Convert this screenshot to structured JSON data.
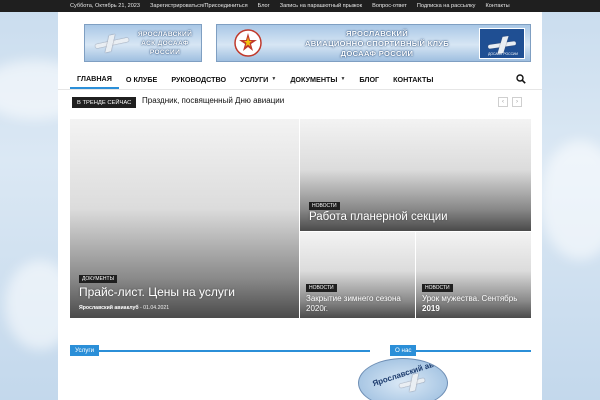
{
  "topbar": {
    "date": "Суббота, Октябрь 21, 2023",
    "links": [
      "Зарегистрироваться/Присоединиться",
      "Блог",
      "Запись на парашютный прыжок",
      "Вопрос-ответ",
      "Подписка на рассылку",
      "Контакты"
    ]
  },
  "banners": {
    "left": {
      "line1": "ЯРОСЛАВСКИЙ",
      "line2": "АСК ДОСААФ",
      "line3": "РОССИИ"
    },
    "right": {
      "line1": "ЯРОСЛАВСКИЙ",
      "line2": "АВИАЦИОННО-СПОРТИВНЫЙ КЛУБ",
      "line3": "ДОСААФ РОССИИ",
      "emblem": "ДОСААФ РОССИИ"
    }
  },
  "nav": {
    "items": [
      {
        "label": "ГЛАВНАЯ",
        "active": true,
        "dropdown": false
      },
      {
        "label": "О КЛУБЕ",
        "active": false,
        "dropdown": false
      },
      {
        "label": "РУКОВОДСТВО",
        "active": false,
        "dropdown": false
      },
      {
        "label": "УСЛУГИ",
        "active": false,
        "dropdown": true
      },
      {
        "label": "ДОКУМЕНТЫ",
        "active": false,
        "dropdown": true
      },
      {
        "label": "БЛОГ",
        "active": false,
        "dropdown": false
      },
      {
        "label": "КОНТАКТЫ",
        "active": false,
        "dropdown": false
      }
    ],
    "search_icon": "search-icon"
  },
  "trending": {
    "label": "В ТРЕНДЕ СЕЙЧАС",
    "headline": "Праздник, посвященный Дню авиации",
    "prev": "‹",
    "next": "›"
  },
  "tiles": {
    "main": {
      "category": "ДОКУМЕНТЫ",
      "title": "Прайс-лист. Цены на услуги",
      "author": "Ярославский авиаклуб",
      "date": "01.04.2021"
    },
    "top_right": {
      "category": "НОВОСТИ",
      "title": "Работа планерной секции"
    },
    "bottom_left": {
      "category": "НОВОСТИ",
      "title_line1": "Закрытие зимнего сезона",
      "title_line2": "2020г."
    },
    "bottom_right": {
      "category": "НОВОСТИ",
      "title_line1": "Урок мужества. Сентябрь",
      "title_line2": "2019"
    }
  },
  "sections": {
    "services": "Услуги",
    "about": "О нас",
    "about_logo_text": "Ярославский авиа"
  },
  "colors": {
    "accent": "#2b8fd8",
    "topbar": "#1f1f1f",
    "badge": "#1f1f1f"
  }
}
